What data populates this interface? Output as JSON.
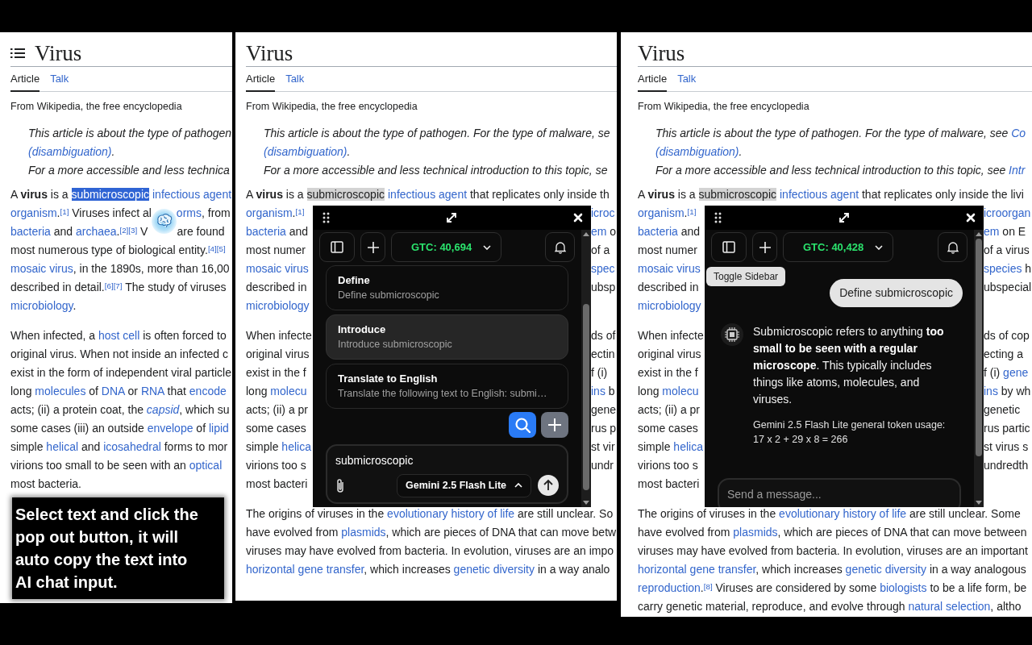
{
  "panels": [
    {
      "title": "Virus",
      "menu": true,
      "tabs": [
        {
          "label": "Article",
          "selected": true
        },
        {
          "label": "Talk",
          "selected": false
        }
      ],
      "tagline": "From Wikipedia, the free encyclopedia",
      "hatnote": [
        [
          "This article is about the type of pathogen"
        ],
        [
          {
            "text": "(disambiguation)",
            "kind": "link"
          },
          "."
        ],
        [
          "For a more accessible and less technica"
        ]
      ],
      "paragraphs": [
        [
          [
            "A ",
            {
              "text": "virus",
              "kind": "bold"
            },
            " is a ",
            {
              "text": "submicroscopic",
              "kind": "selection"
            },
            {
              "text": "infectious agent",
              "kind": "link"
            }
          ],
          [
            {
              "text": "organism",
              "kind": "link"
            },
            ".",
            {
              "text": "[1]",
              "kind": "sup"
            },
            " Viruses infect al",
            {
              "kind": "gap"
            },
            {
              "text": "orms",
              "kind": "link"
            },
            ", from"
          ],
          [
            {
              "text": "bacteria",
              "kind": "link"
            },
            " and ",
            {
              "text": "archaea",
              "kind": "link"
            },
            ".",
            {
              "text": "[2][3]",
              "kind": "sup"
            },
            " V",
            {
              "kind": "gap"
            },
            "are found"
          ],
          [
            "most numerous type of biological entity.",
            {
              "text": "[4][5]",
              "kind": "sup"
            }
          ],
          [
            {
              "text": "mosaic virus",
              "kind": "link"
            },
            ", in the 1890s, more than 16,00"
          ],
          [
            "described in detail.",
            {
              "text": "[6][7]",
              "kind": "sup"
            },
            " The study of viruses"
          ],
          [
            {
              "text": "microbiology",
              "kind": "link"
            },
            "."
          ]
        ],
        [
          [
            "When infected, a ",
            {
              "text": "host cell",
              "kind": "link"
            },
            " is often forced to"
          ],
          [
            "original virus. When not inside an infected c"
          ],
          [
            "exist in the form of independent viral particle"
          ],
          [
            "long ",
            {
              "text": "molecules",
              "kind": "link"
            },
            " of ",
            {
              "text": "DNA",
              "kind": "link"
            },
            " or ",
            {
              "text": "RNA",
              "kind": "link"
            },
            " that ",
            {
              "text": "encode",
              "kind": "link"
            }
          ],
          [
            "acts; (ii) a protein coat, the ",
            {
              "text": "capsid",
              "kind": "italic-link"
            },
            ", which su"
          ],
          [
            "some cases (iii) an outside ",
            {
              "text": "envelope",
              "kind": "link"
            },
            " of ",
            {
              "text": "lipid",
              "kind": "link"
            }
          ],
          [
            "simple ",
            {
              "text": "helical",
              "kind": "link"
            },
            " and ",
            {
              "text": "icosahedral",
              "kind": "link"
            },
            " forms to mor"
          ],
          [
            "virions too small to be seen with an ",
            {
              "text": "optical",
              "kind": "link"
            }
          ],
          [
            "most bacteria."
          ]
        ]
      ],
      "floating_button": true,
      "callout": "Select text and click the pop out button, it will auto copy the text into AI chat input."
    },
    {
      "title": "Virus",
      "menu": false,
      "tabs": [
        {
          "label": "Article",
          "selected": true
        },
        {
          "label": "Talk",
          "selected": false
        }
      ],
      "tagline": "From Wikipedia, the free encyclopedia",
      "hatnote": [
        [
          "This article is about the type of pathogen. For the type of malware, se"
        ],
        [
          {
            "text": "(disambiguation)",
            "kind": "link"
          },
          "."
        ],
        [
          "For a more accessible and less technical introduction to this topic, se"
        ]
      ],
      "paragraphs": [
        [
          [
            "A ",
            {
              "text": "virus",
              "kind": "bold"
            },
            " is a ",
            {
              "text": "submicroscopic",
              "kind": "highlight"
            },
            {
              "text": "infectious agent",
              "kind": "link"
            },
            " that replicates only inside th"
          ],
          [
            {
              "text": "organism",
              "kind": "link"
            },
            ".",
            {
              "text": "[1]",
              "kind": "sup"
            },
            {
              "kind": "gap"
            },
            {
              "text": "icroc",
              "kind": "link"
            }
          ],
          [
            {
              "text": "bacteria",
              "kind": "link"
            },
            " and",
            {
              "kind": "gap"
            },
            {
              "text": "em",
              "kind": "link"
            },
            " o"
          ],
          [
            "most numer",
            {
              "kind": "gap"
            },
            "of a"
          ],
          [
            {
              "text": "mosaic virus",
              "kind": "link"
            },
            {
              "kind": "gap"
            },
            {
              "text": "spec",
              "kind": "link"
            }
          ],
          [
            "described in",
            {
              "kind": "gap"
            },
            "ubsp"
          ],
          [
            {
              "text": "microbiology",
              "kind": "link"
            }
          ]
        ],
        [
          [
            "When infecte",
            {
              "kind": "gap"
            },
            "ds of"
          ],
          [
            "original virus",
            {
              "kind": "gap"
            },
            "ectin"
          ],
          [
            "exist in the f",
            {
              "kind": "gap"
            },
            "f (i)"
          ],
          [
            "long ",
            {
              "text": "molecu",
              "kind": "link"
            },
            {
              "kind": "gap"
            },
            {
              "text": "ins",
              "kind": "link"
            },
            " b"
          ],
          [
            "acts; (ii) a pr",
            {
              "kind": "gap"
            },
            "gene"
          ],
          [
            "some cases",
            {
              "kind": "gap"
            },
            "rus p"
          ],
          [
            "simple ",
            {
              "text": "helica",
              "kind": "link"
            },
            {
              "kind": "gap"
            },
            "st vir"
          ],
          [
            "virions too s",
            {
              "kind": "gap"
            },
            "undr"
          ],
          [
            "most bacteri"
          ]
        ],
        [
          [
            "The origins of viruses in the ",
            {
              "text": "evolutionary history of life",
              "kind": "link"
            },
            " are still unclear. So"
          ],
          [
            "have evolved from ",
            {
              "text": "plasmids",
              "kind": "link"
            },
            ", which are pieces of DNA that can move betw"
          ],
          [
            "viruses may have evolved from bacteria. In evolution, viruses are an impo"
          ],
          [
            {
              "text": "horizontal gene transfer",
              "kind": "link"
            },
            ", which increases ",
            {
              "text": "genetic diversity",
              "kind": "link"
            },
            " in a way analo"
          ]
        ]
      ],
      "popup": {
        "credits": "GTC: 40,694",
        "prompts": [
          {
            "title": "Define",
            "description": "Define submicroscopic",
            "selected": false
          },
          {
            "title": "Introduce",
            "description": "Introduce submicroscopic",
            "selected": true
          },
          {
            "title": "Translate to English",
            "description": "Translate the following text to English: submi…",
            "selected": false
          }
        ],
        "input": {
          "value": "submicroscopic",
          "model": "Gemini 2.5 Flash Lite"
        }
      }
    },
    {
      "title": "Virus",
      "menu": false,
      "tabs": [
        {
          "label": "Article",
          "selected": true
        },
        {
          "label": "Talk",
          "selected": false
        }
      ],
      "tagline": "From Wikipedia, the free encyclopedia",
      "hatnote": [
        [
          "This article is about the type of pathogen. For the type of malware, see ",
          {
            "text": "Co",
            "kind": "link"
          }
        ],
        [
          {
            "text": "(disambiguation)",
            "kind": "link"
          },
          "."
        ],
        [
          "For a more accessible and less technical introduction to this topic, see ",
          {
            "text": "Intr",
            "kind": "link"
          }
        ]
      ],
      "paragraphs": [
        [
          [
            "A ",
            {
              "text": "virus",
              "kind": "bold"
            },
            " is a ",
            {
              "text": "submicroscopic",
              "kind": "highlight"
            },
            {
              "text": "infectious agent",
              "kind": "link"
            },
            " that replicates only inside the livi"
          ],
          [
            {
              "text": "organism",
              "kind": "link"
            },
            ".",
            {
              "text": "[1]",
              "kind": "sup"
            },
            {
              "kind": "gap"
            },
            {
              "text": "icroorgan",
              "kind": "link"
            }
          ],
          [
            {
              "text": "bacteria",
              "kind": "link"
            },
            " and",
            {
              "kind": "gap"
            },
            {
              "text": "em",
              "kind": "link"
            },
            " on E"
          ],
          [
            "most numer",
            {
              "kind": "gap"
            },
            "of a virus"
          ],
          [
            {
              "text": "mosaic virus",
              "kind": "link"
            },
            {
              "kind": "gap"
            },
            {
              "text": "species",
              "kind": "link"
            },
            " h"
          ],
          [
            "described in",
            {
              "kind": "gap"
            },
            "ubspecial"
          ],
          [
            {
              "text": "microbiology",
              "kind": "link"
            }
          ]
        ],
        [
          [
            "When infecte",
            {
              "kind": "gap"
            },
            "ds of cop"
          ],
          [
            "original virus",
            {
              "kind": "gap"
            },
            "ecting a"
          ],
          [
            "exist in the f",
            {
              "kind": "gap"
            },
            "f (i) ",
            {
              "text": "gene",
              "kind": "link"
            }
          ],
          [
            "long ",
            {
              "text": "molecu",
              "kind": "link"
            },
            {
              "kind": "gap"
            },
            {
              "text": "ins",
              "kind": "link"
            },
            " by wh"
          ],
          [
            "acts; (ii) a pr",
            {
              "kind": "gap"
            },
            "genetic"
          ],
          [
            "some cases",
            {
              "kind": "gap"
            },
            "rus partic"
          ],
          [
            "simple ",
            {
              "text": "helica",
              "kind": "link"
            },
            {
              "kind": "gap"
            },
            "st virus s"
          ],
          [
            "virions too s",
            {
              "kind": "gap"
            },
            "undredth"
          ],
          [
            "most bacteri"
          ]
        ],
        [
          [
            "The origins of viruses in the ",
            {
              "text": "evolutionary history of life",
              "kind": "link"
            },
            " are still unclear. Some"
          ],
          [
            "have evolved from ",
            {
              "text": "plasmids",
              "kind": "link"
            },
            ", which are pieces of DNA that can move between"
          ],
          [
            "viruses may have evolved from bacteria. In evolution, viruses are an important"
          ],
          [
            {
              "text": "horizontal gene transfer",
              "kind": "link"
            },
            ", which increases ",
            {
              "text": "genetic diversity",
              "kind": "link"
            },
            " in a way analogous"
          ],
          [
            {
              "text": "reproduction",
              "kind": "link"
            },
            ".",
            {
              "text": "[8]",
              "kind": "sup"
            },
            " Viruses are considered by some ",
            {
              "text": "biologists",
              "kind": "link"
            },
            " to be a life form, be"
          ],
          [
            "carry genetic material, reproduce, and evolve through ",
            {
              "text": "natural selection",
              "kind": "link"
            },
            ", altho"
          ]
        ]
      ],
      "popup": {
        "credits": "GTC: 40,428",
        "tooltip": "Toggle Sidebar",
        "messages": [
          {
            "kind": "user",
            "text": "Define submicroscopic"
          },
          {
            "kind": "assistant",
            "text": "Submicroscopic refers to anything **too small to be seen with a regular microscope**. This typically includes things like atoms, molecules, and viruses.",
            "usage": "Gemini 2.5 Flash Lite general token usage: 17 x 2 + 29 x 8 = 266"
          }
        ],
        "input": {
          "placeholder": "Send a message..."
        }
      }
    }
  ]
}
